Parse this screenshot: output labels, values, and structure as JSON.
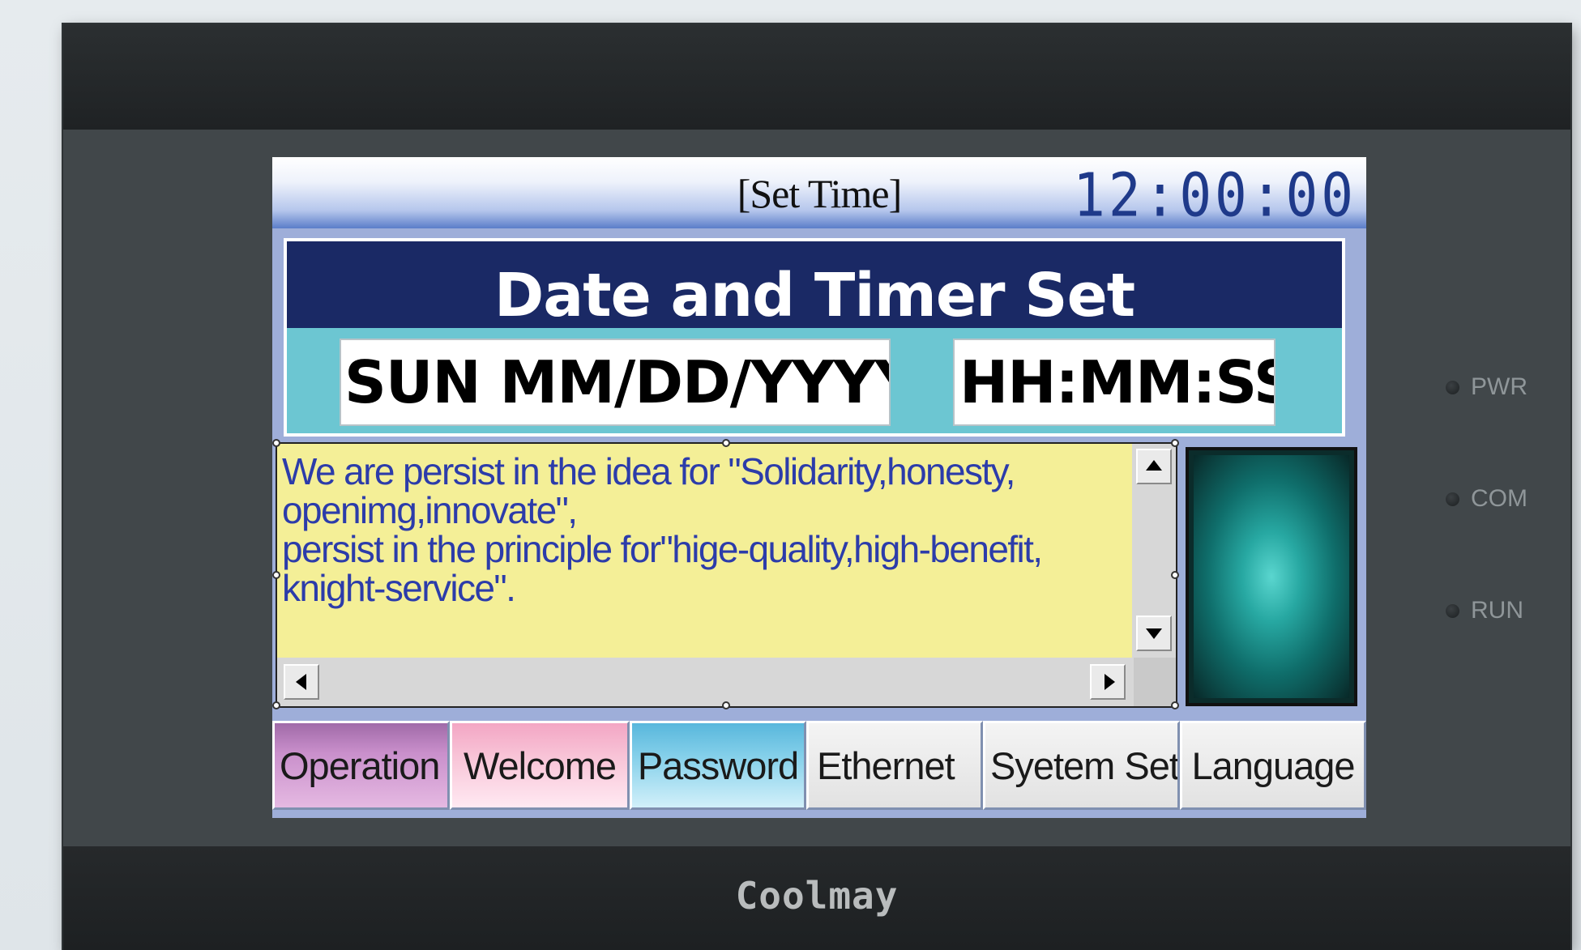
{
  "screen": {
    "title": "[Set Time]",
    "clock": "12:00:00"
  },
  "panel": {
    "title": "Date and Timer Set",
    "date_field": "SUN MM/DD/YYYY",
    "time_field": "HH:MM:SS"
  },
  "message": {
    "text": "We are persist in the idea for \"Solidarity,honesty,\nopenimg,innovate\",\npersist in the principle for\"hige-quality,high-benefit,\nknight-service\"."
  },
  "tabs": [
    {
      "label": "Operation"
    },
    {
      "label": "Welcome"
    },
    {
      "label": "Password"
    },
    {
      "label": "Ethernet"
    },
    {
      "label": "Syetem Set"
    },
    {
      "label": "Language"
    }
  ],
  "device": {
    "brand": "Coolmay",
    "leds": [
      {
        "label": "PWR"
      },
      {
        "label": "COM"
      },
      {
        "label": "RUN"
      }
    ]
  },
  "colors": {
    "header_navy": "#1a2965",
    "panel_teal": "#6cc6d2",
    "message_bg": "#f4ef97",
    "message_text": "#2c3caa",
    "clock_blue": "#1f3a8a"
  }
}
